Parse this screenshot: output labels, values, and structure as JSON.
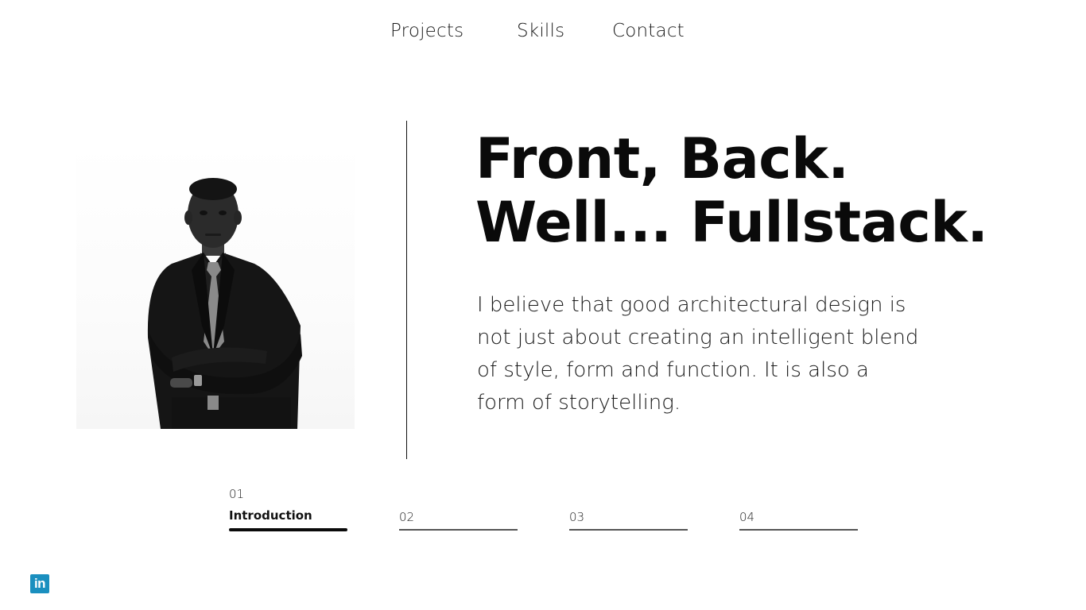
{
  "nav": {
    "items": [
      {
        "label": "Projects"
      },
      {
        "label": "Skills"
      },
      {
        "label": "Contact"
      }
    ]
  },
  "hero": {
    "headline_line1": "Front, Back.",
    "headline_line2": "Well... Fullstack.",
    "paragraph": "I believe that good architectural design is not just about creating an intelligent blend of style, form and function. It is also a form of storytelling."
  },
  "slider": {
    "tabs": [
      {
        "number": "01",
        "label": "Introduction",
        "active": true
      },
      {
        "number": "02",
        "label": "",
        "active": false
      },
      {
        "number": "03",
        "label": "",
        "active": false
      },
      {
        "number": "04",
        "label": "",
        "active": false
      }
    ]
  },
  "social": {
    "linkedin_glyph": "in",
    "linkedin_color": "#1a8fbf",
    "icon": "linkedin-icon"
  },
  "portrait": {
    "icon": "portrait-photo"
  }
}
